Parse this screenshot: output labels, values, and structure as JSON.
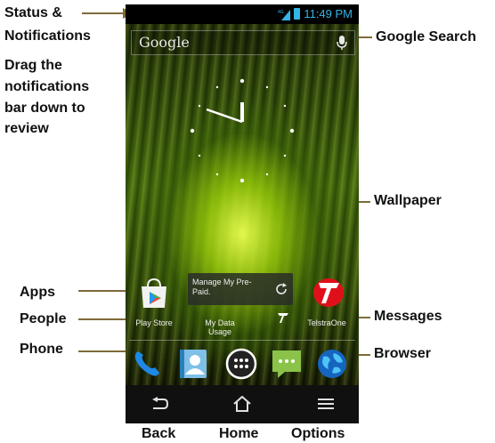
{
  "callouts": {
    "status": "Status &",
    "notifications": "Notifications",
    "drag_1": "Drag the",
    "drag_2": "notifications",
    "drag_3": "bar down to",
    "drag_4": "review",
    "google_search": "Google Search",
    "wallpaper": "Wallpaper",
    "apps": "Apps",
    "people": "People",
    "messages": "Messages",
    "phone": "Phone",
    "browser": "Browser",
    "back": "Back",
    "home": "Home",
    "options": "Options"
  },
  "status_bar": {
    "network": "4G",
    "time": "11:49 PM"
  },
  "search": {
    "logo": "Google"
  },
  "widget": {
    "text": "Manage My Pre-Paid."
  },
  "home_apps": [
    {
      "label": "Play Store"
    },
    {
      "label": "My Data Usage"
    },
    {
      "label": "TelstraOne"
    }
  ],
  "colors": {
    "accent": "#33b5e5",
    "callout_line": "#7f6b3a",
    "telstra_red": "#e0101a"
  }
}
